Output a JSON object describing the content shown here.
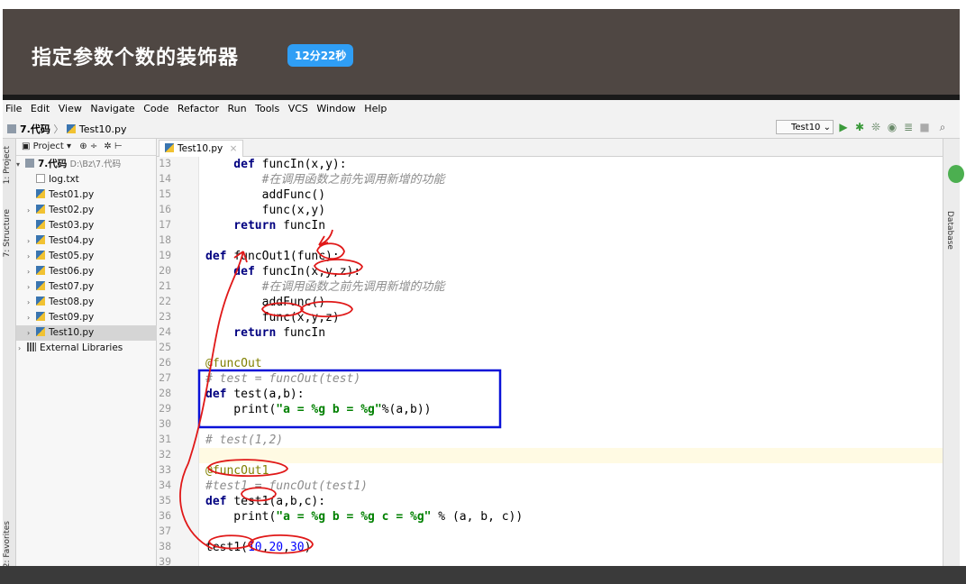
{
  "banner": {
    "title": "指定参数个数的装饰器",
    "badge": "12分22秒"
  },
  "menu": [
    "File",
    "Edit",
    "View",
    "Navigate",
    "Code",
    "Refactor",
    "Run",
    "Tools",
    "VCS",
    "Window",
    "Help"
  ],
  "breadcrumb": {
    "folder": "7.代码",
    "file": "Test10.py"
  },
  "run_config": "Test10",
  "left_tabs": [
    "1: Project",
    "7: Structure",
    "2: Favorites"
  ],
  "project": {
    "header": "Project",
    "root": "7.代码",
    "root_path": "D:\\Bz\\7.代码",
    "items": [
      "log.txt",
      "Test01.py",
      "Test02.py",
      "Test03.py",
      "Test04.py",
      "Test05.py",
      "Test06.py",
      "Test07.py",
      "Test08.py",
      "Test09.py",
      "Test10.py"
    ],
    "external": "External Libraries"
  },
  "editor": {
    "tab": "Test10.py",
    "line_numbers": [
      "13",
      "14",
      "15",
      "16",
      "17",
      "18",
      "19",
      "20",
      "21",
      "22",
      "23",
      "24",
      "25",
      "26",
      "27",
      "28",
      "29",
      "30",
      "31",
      "32",
      "33",
      "34",
      "35",
      "36",
      "37",
      "38",
      "39"
    ],
    "lines": {
      "l13a": "    def ",
      "l13b": "funcIn(x,y):",
      "l14": "        #在调用函数之前先调用新增的功能",
      "l15": "        addFunc()",
      "l16": "        func(x,y)",
      "l17a": "    return ",
      "l17b": "funcIn",
      "l19a": "def ",
      "l19b": "funcOut1(func):",
      "l20a": "    def ",
      "l20b": "funcIn(x,y,z):",
      "l21": "        #在调用函数之前先调用新增的功能",
      "l22": "        addFunc()",
      "l23": "        func(x,y,z)",
      "l24a": "    return ",
      "l24b": "funcIn",
      "l26": "@funcOut",
      "l27": "# test = funcOut(test)",
      "l28a": "def ",
      "l28b": "test(a,b):",
      "l29a": "    print(",
      "l29b": "\"a = %g b = %g\"",
      "l29c": "%(a,b))",
      "l31": "# test(1,2)",
      "l33": "@funcOut1",
      "l34": "#test1 = funcOut(test1)",
      "l35a": "def ",
      "l35b": "test1(a,b,c):",
      "l36a": "    print(",
      "l36b": "\"a = %g b = %g c = %g\"",
      "l36c": " % (a, b, c))",
      "l38a": "test1(",
      "l38b": "10",
      "l38c": ",",
      "l38d": "20",
      "l38e": ",",
      "l38f": "30",
      "l38g": ")"
    }
  },
  "right_tabs": [
    "Database"
  ]
}
